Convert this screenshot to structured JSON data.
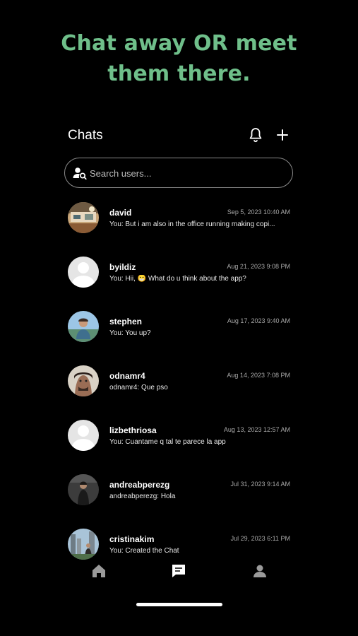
{
  "headline": {
    "line1": "Chat away OR meet",
    "line2": "them there."
  },
  "header": {
    "title": "Chats",
    "bell_icon": "bell-icon",
    "add_icon": "plus-icon"
  },
  "search": {
    "placeholder": "Search users...",
    "value": "",
    "icon": "user-search-icon"
  },
  "chats": [
    {
      "name": "david",
      "time": "Sep 5, 2023 10:40 AM",
      "preview": "You: But i am also in the office running making copi...",
      "avatar": "photo"
    },
    {
      "name": "byildiz",
      "time": "Aug 21, 2023 9:08 PM",
      "preview": "You: Hii, 😁 What do u think about the app?",
      "avatar": "default"
    },
    {
      "name": "stephen",
      "time": "Aug 17, 2023 9:40 AM",
      "preview": "You: You up?",
      "avatar": "photo"
    },
    {
      "name": "odnamr4",
      "time": "Aug 14, 2023 7:08 PM",
      "preview": "odnamr4: Que pso",
      "avatar": "photo"
    },
    {
      "name": "lizbethriosa",
      "time": "Aug 13, 2023 12:57 AM",
      "preview": "You: Cuantame q tal te parece la app",
      "avatar": "default"
    },
    {
      "name": "andreabperezg",
      "time": "Jul 31, 2023 9:14 AM",
      "preview": "andreabperezg: Hola",
      "avatar": "photo"
    },
    {
      "name": "cristinakim",
      "time": "Jul 29, 2023 6:11 PM",
      "preview": "You: Created the Chat",
      "avatar": "photo"
    }
  ],
  "tabbar": {
    "active": "chats",
    "items": [
      {
        "id": "home",
        "icon": "home-icon"
      },
      {
        "id": "chats",
        "icon": "chat-bubble-icon"
      },
      {
        "id": "profile",
        "icon": "person-icon"
      }
    ]
  },
  "colors": {
    "background": "#000000",
    "headline": "#6fbf8a",
    "text": "#ffffff",
    "muted": "#a8a8a8",
    "inactive_tab": "#9a9a9a"
  }
}
